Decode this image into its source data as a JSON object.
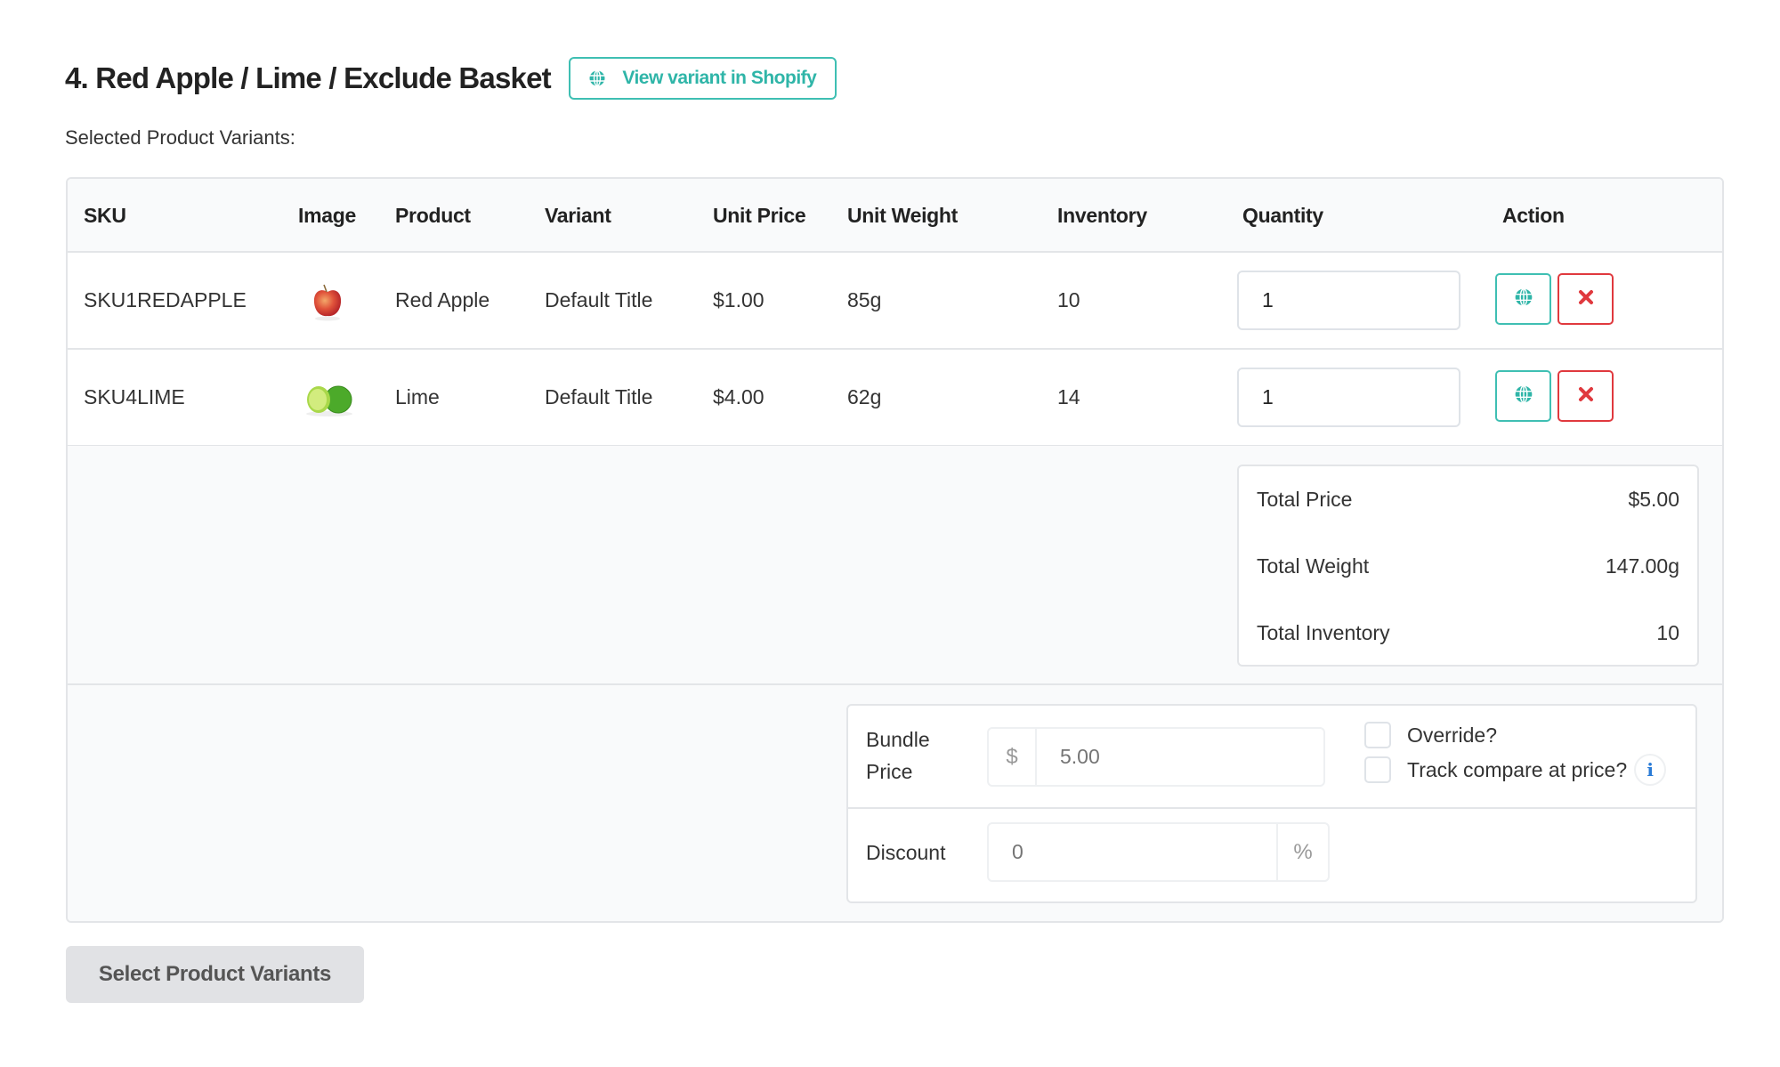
{
  "header": {
    "title": "4. Red Apple / Lime / Exclude Basket",
    "view_shopify_label": "View variant in Shopify",
    "subtitle": "Selected Product Variants:"
  },
  "table": {
    "columns": [
      "SKU",
      "Image",
      "Product",
      "Variant",
      "Unit Price",
      "Unit Weight",
      "Inventory",
      "Quantity",
      "Action"
    ],
    "rows": [
      {
        "sku": "SKU1REDAPPLE",
        "image": "red-apple",
        "product": "Red Apple",
        "variant": "Default Title",
        "unit_price": "$1.00",
        "unit_weight": "85g",
        "inventory": "10",
        "quantity": "1"
      },
      {
        "sku": "SKU4LIME",
        "image": "lime",
        "product": "Lime",
        "variant": "Default Title",
        "unit_price": "$4.00",
        "unit_weight": "62g",
        "inventory": "14",
        "quantity": "1"
      }
    ],
    "action_icons": {
      "view": "globe-icon",
      "remove": "close-icon"
    }
  },
  "totals": {
    "price_label": "Total Price",
    "price_value": "$5.00",
    "weight_label": "Total Weight",
    "weight_value": "147.00g",
    "inventory_label": "Total Inventory",
    "inventory_value": "10"
  },
  "bundle": {
    "price_label_line1": "Bundle",
    "price_label_line2": "Price",
    "currency_symbol": "$",
    "price_placeholder": "5.00",
    "discount_label": "Discount",
    "discount_placeholder": "0",
    "percent_symbol": "%",
    "override_label": "Override?",
    "override_checked": false,
    "track_compare_label": "Track compare at price?",
    "track_compare_checked": false,
    "info_icon": "i"
  },
  "footer": {
    "select_variants_label": "Select Product Variants"
  },
  "colors": {
    "accent_teal": "#3fbfb3",
    "danger_red": "#e0393e",
    "info_blue": "#2a7bd6"
  }
}
